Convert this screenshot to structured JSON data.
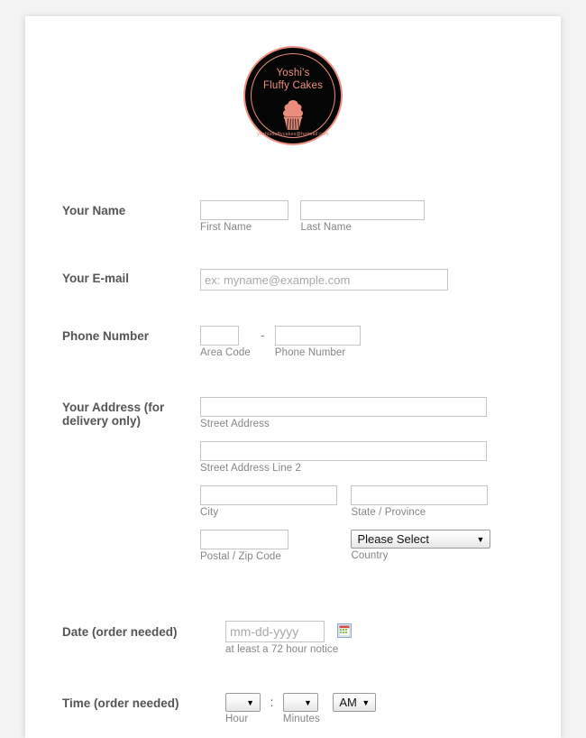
{
  "logo": {
    "title_line1": "Yoshi's",
    "title_line2": "Fluffy Cakes",
    "email": "yoshisfluffycakes@hotmail.com",
    "ring_color": "#ef9180",
    "text_color": "#f0907f",
    "background_color": "#050505",
    "cupcake_color": "#e98e7d",
    "icon": "cupcake-icon"
  },
  "form": {
    "name": {
      "label": "Your Name",
      "first": {
        "value": "",
        "placeholder": "",
        "sublabel": "First Name"
      },
      "last": {
        "value": "",
        "placeholder": "",
        "sublabel": "Last Name"
      }
    },
    "email": {
      "label": "Your E-mail",
      "value": "",
      "placeholder": "ex: myname@example.com"
    },
    "phone": {
      "label": "Phone Number",
      "separator": "-",
      "area": {
        "value": "",
        "sublabel": "Area Code"
      },
      "number": {
        "value": "",
        "sublabel": "Phone Number"
      }
    },
    "address": {
      "label": "Your Address (for delivery only)",
      "street": {
        "value": "",
        "sublabel": "Street Address"
      },
      "street2": {
        "value": "",
        "sublabel": "Street Address Line 2"
      },
      "city": {
        "value": "",
        "sublabel": "City"
      },
      "state": {
        "value": "",
        "sublabel": "State / Province"
      },
      "postal": {
        "value": "",
        "sublabel": "Postal / Zip Code"
      },
      "country": {
        "selected": "Please Select",
        "sublabel": "Country",
        "caret": "▼"
      }
    },
    "date": {
      "label": "Date (order needed)",
      "value": "",
      "placeholder": "mm-dd-yyyy",
      "sublabel": "at least a 72 hour notice",
      "picker_icon": "calendar-icon"
    },
    "time": {
      "label": "Time (order needed)",
      "hour": {
        "selected": "",
        "sublabel": "Hour",
        "caret": "▼"
      },
      "separator": ":",
      "minutes": {
        "selected": "",
        "sublabel": "Minutes",
        "caret": "▼"
      },
      "meridiem": {
        "selected": "AM",
        "caret": "▼"
      }
    }
  }
}
